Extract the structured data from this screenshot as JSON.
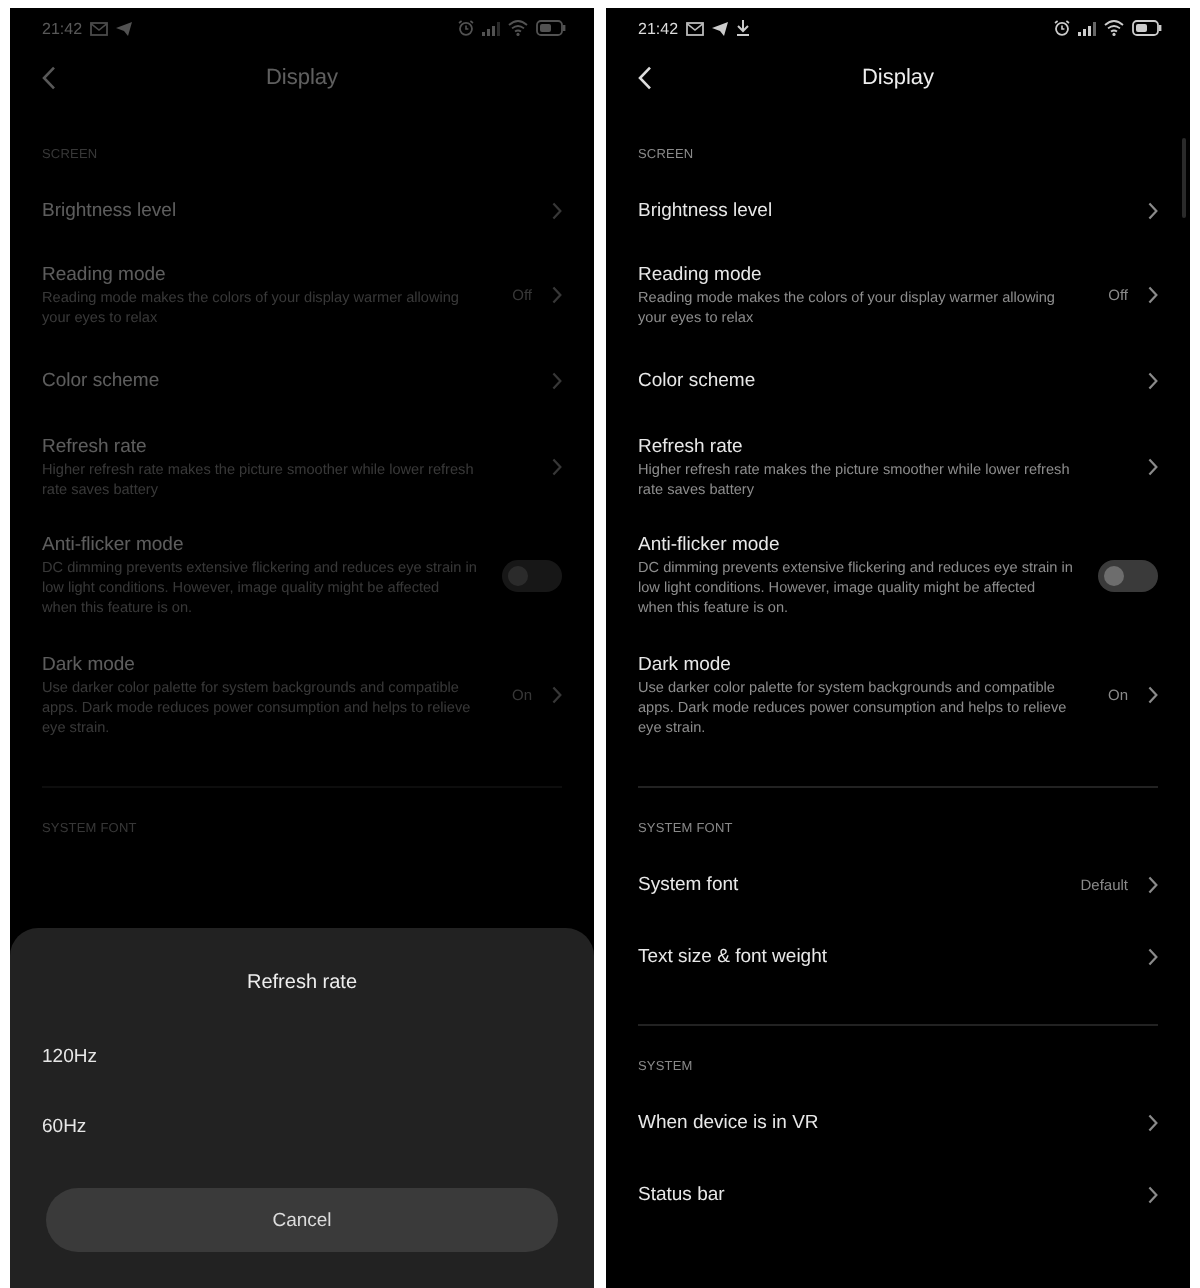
{
  "screens": [
    {
      "status_bar": {
        "time": "21:42",
        "notifications": [
          {
            "kind": "mail"
          },
          {
            "kind": "send"
          }
        ]
      },
      "title": "Display",
      "sections": [
        {
          "header": "SCREEN",
          "items": [
            {
              "kind": "link",
              "title": "Brightness level"
            },
            {
              "kind": "link",
              "title": "Reading mode",
              "subtitle": "Reading mode makes the colors of your display warmer allowing your eyes to relax",
              "value": "Off"
            },
            {
              "kind": "link",
              "title": "Color scheme"
            },
            {
              "kind": "link",
              "title": "Refresh rate",
              "subtitle": "Higher refresh rate makes the picture smoother while lower refresh rate saves battery"
            },
            {
              "kind": "switch",
              "title": "Anti-flicker mode",
              "subtitle": "DC dimming prevents extensive flickering and reduces eye strain in low light conditions. However, image quality might be affected when this feature is on.",
              "on": false
            },
            {
              "kind": "link",
              "title": "Dark mode",
              "subtitle": "Use darker color palette for system backgrounds and compatible apps. Dark mode reduces power consumption and helps to relieve eye strain.",
              "value": "On"
            }
          ]
        },
        {
          "header": "SYSTEM FONT"
        }
      ],
      "dialog": {
        "title": "Refresh rate",
        "options": [
          "120Hz",
          "60Hz"
        ],
        "cancel": "Cancel"
      }
    },
    {
      "status_bar": {
        "time": "21:42",
        "notifications": [
          {
            "kind": "mail"
          },
          {
            "kind": "send"
          },
          {
            "kind": "download"
          }
        ]
      },
      "title": "Display",
      "sections": [
        {
          "header": "SCREEN",
          "items": [
            {
              "kind": "link",
              "title": "Brightness level"
            },
            {
              "kind": "link",
              "title": "Reading mode",
              "subtitle": "Reading mode makes the colors of your display warmer allowing your eyes to relax",
              "value": "Off"
            },
            {
              "kind": "link",
              "title": "Color scheme"
            },
            {
              "kind": "link",
              "title": "Refresh rate",
              "subtitle": "Higher refresh rate makes the picture smoother while lower refresh rate saves battery"
            },
            {
              "kind": "switch",
              "title": "Anti-flicker mode",
              "subtitle": "DC dimming prevents extensive flickering and reduces eye strain in low light conditions. However, image quality might be affected when this feature is on.",
              "on": false
            },
            {
              "kind": "link",
              "title": "Dark mode",
              "subtitle": "Use darker color palette for system backgrounds and compatible apps. Dark mode reduces power consumption and helps to relieve eye strain.",
              "value": "On"
            }
          ]
        },
        {
          "header": "SYSTEM FONT",
          "items": [
            {
              "kind": "link",
              "title": "System font",
              "value": "Default"
            },
            {
              "kind": "link",
              "title": "Text size & font weight"
            }
          ]
        },
        {
          "header": "SYSTEM",
          "items": [
            {
              "kind": "link",
              "title": "When device is in VR"
            },
            {
              "kind": "link",
              "title": "Status bar"
            }
          ]
        }
      ]
    }
  ]
}
